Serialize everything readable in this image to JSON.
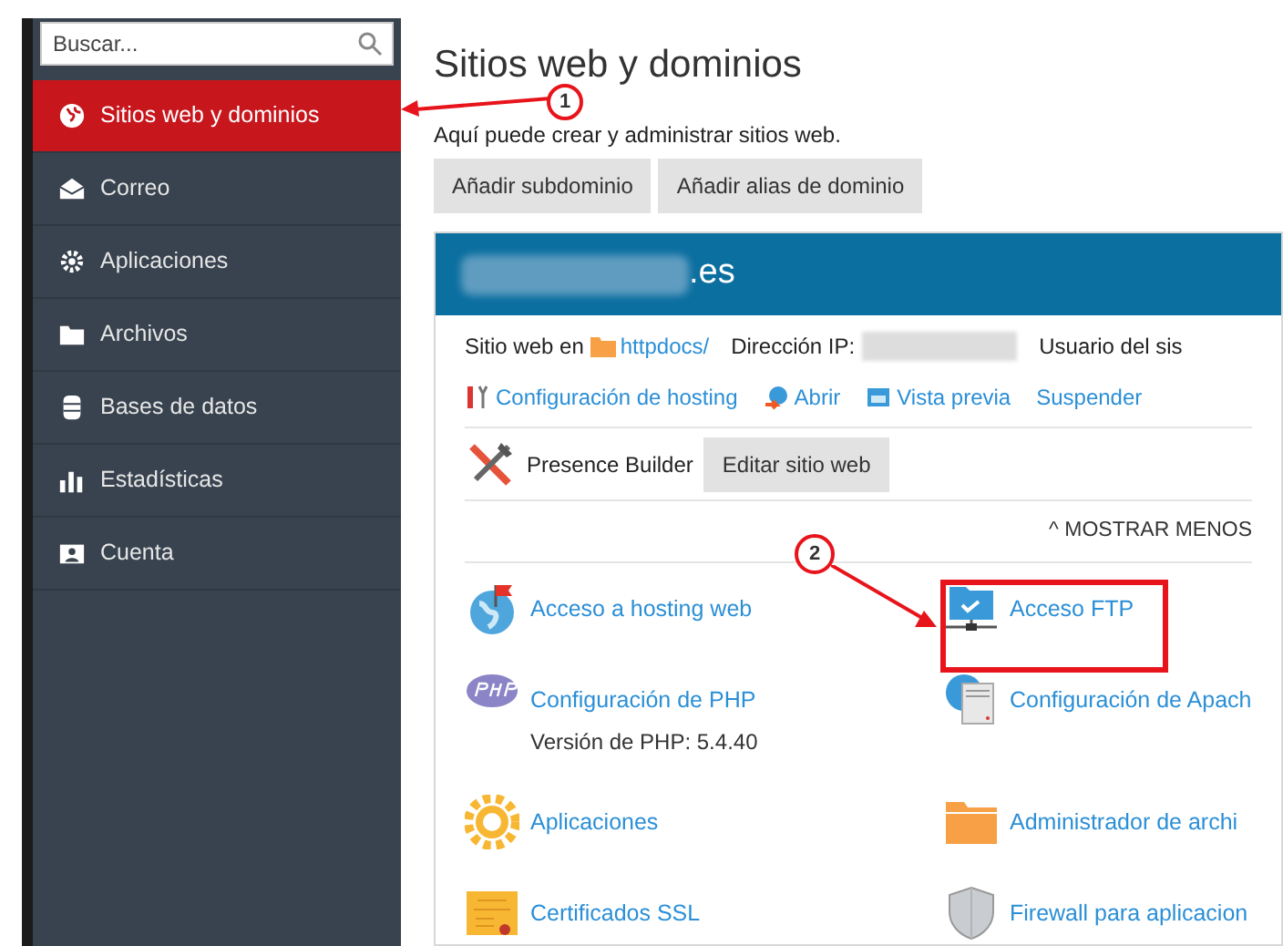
{
  "sidebar": {
    "search": {
      "placeholder": "Buscar..."
    },
    "items": [
      {
        "label": "Sitios web y dominios",
        "kind": "globe",
        "selected": true
      },
      {
        "label": "Correo",
        "kind": "mail",
        "selected": false
      },
      {
        "label": "Aplicaciones",
        "kind": "gear",
        "selected": false
      },
      {
        "label": "Archivos",
        "kind": "folder",
        "selected": false
      },
      {
        "label": "Bases de datos",
        "kind": "db",
        "selected": false
      },
      {
        "label": "Estadísticas",
        "kind": "chart",
        "selected": false
      },
      {
        "label": "Cuenta",
        "kind": "account",
        "selected": false
      }
    ]
  },
  "main": {
    "title": "Sitios web y dominios",
    "subtitle": "Aquí puede crear y administrar sitios web.",
    "buttons": [
      "Añadir subdominio",
      "Añadir alias de dominio"
    ],
    "domain": {
      "name": ".es",
      "info": {
        "site_label": "Sitio web en",
        "folder": "httpdocs/",
        "ip_label": "Dirección IP:",
        "user_label": "Usuario del sis"
      },
      "links": [
        {
          "label": "Configuración de hosting",
          "kind": "tools"
        },
        {
          "label": "Abrir",
          "kind": "open"
        },
        {
          "label": "Vista previa",
          "kind": "preview"
        },
        {
          "label": "Suspender",
          "kind": "plain"
        }
      ],
      "builder": {
        "label": "Presence Builder",
        "button": "Editar sitio web"
      },
      "toggle": "^ MOSTRAR MENOS",
      "tools": [
        {
          "label": "Acceso a hosting web",
          "kind": "globe-flag"
        },
        {
          "label": "Acceso FTP",
          "kind": "ftp"
        },
        {
          "label": "Configuración de PHP",
          "kind": "php",
          "note": "Versión de PHP: 5.4.40"
        },
        {
          "label": "Configuración de Apach",
          "kind": "apache"
        },
        {
          "label": "Aplicaciones",
          "kind": "sun"
        },
        {
          "label": "Administrador de archi",
          "kind": "folder"
        },
        {
          "label": "Certificados SSL",
          "kind": "cert"
        },
        {
          "label": "Firewall para aplicacion",
          "kind": "shield"
        }
      ]
    }
  },
  "annotations": [
    {
      "number": "1"
    },
    {
      "number": "2"
    }
  ]
}
